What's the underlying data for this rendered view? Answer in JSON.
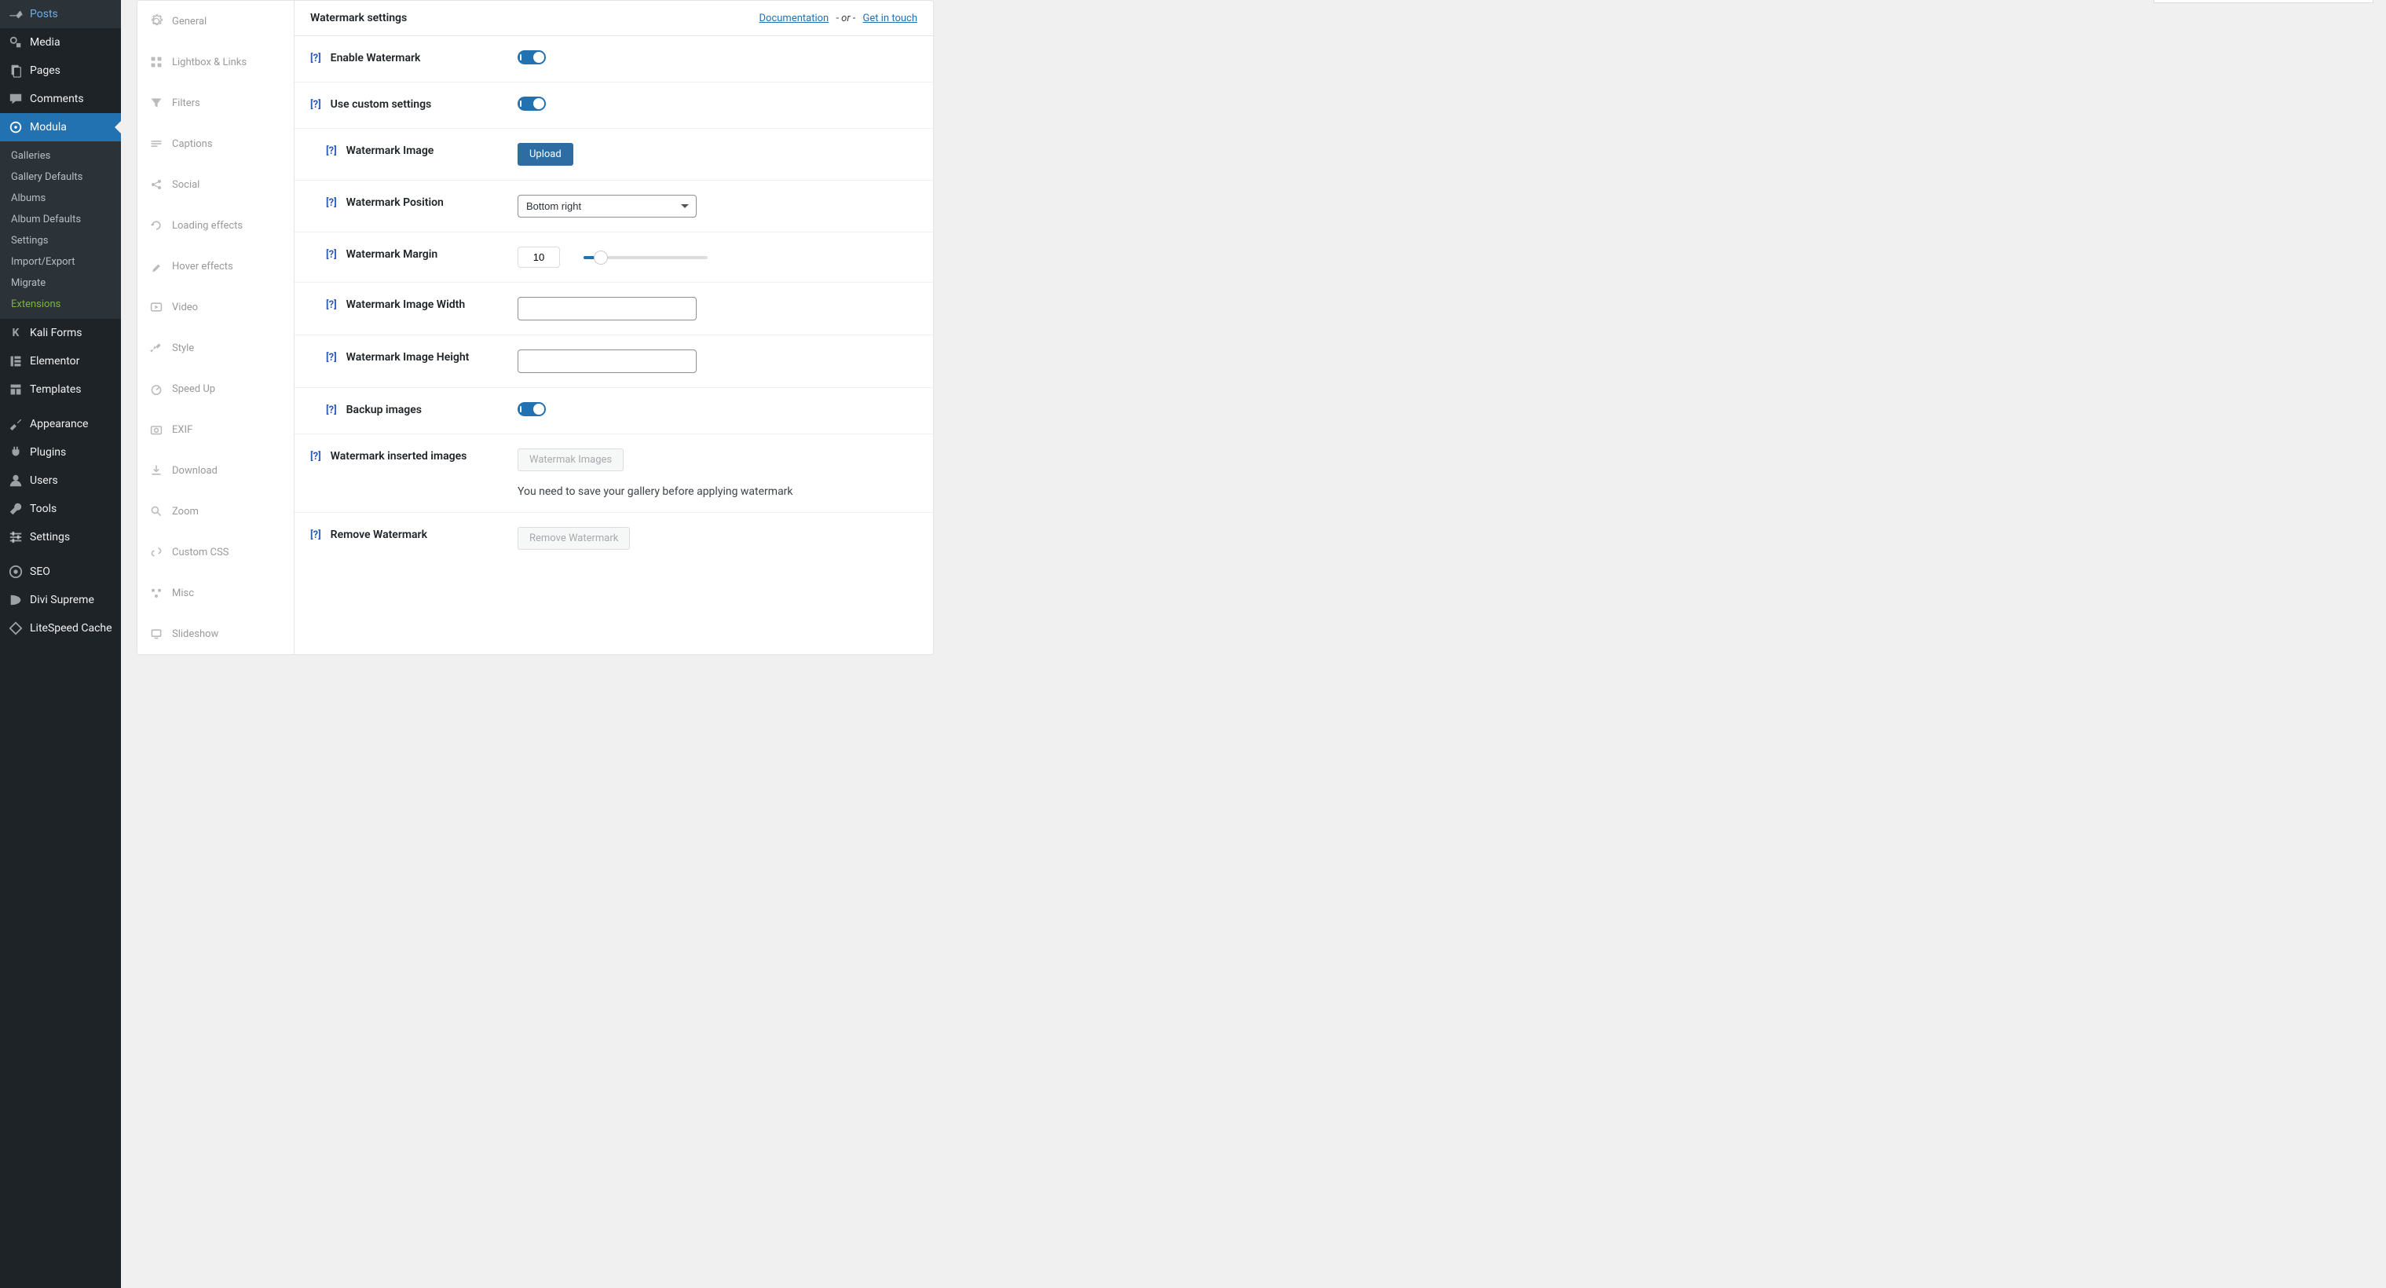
{
  "sidebar": {
    "items": [
      {
        "icon": "pin",
        "label": "Posts"
      },
      {
        "icon": "media",
        "label": "Media"
      },
      {
        "icon": "page",
        "label": "Pages"
      },
      {
        "icon": "comment",
        "label": "Comments"
      },
      {
        "icon": "modula",
        "label": "Modula",
        "active": true
      },
      {
        "icon": "k",
        "label": "Kali Forms"
      },
      {
        "icon": "elementor",
        "label": "Elementor"
      },
      {
        "icon": "template",
        "label": "Templates"
      },
      {
        "icon": "appearance",
        "label": "Appearance"
      },
      {
        "icon": "plugin",
        "label": "Plugins"
      },
      {
        "icon": "user",
        "label": "Users"
      },
      {
        "icon": "tools",
        "label": "Tools"
      },
      {
        "icon": "settings",
        "label": "Settings"
      },
      {
        "icon": "seo",
        "label": "SEO"
      },
      {
        "icon": "divi",
        "label": "Divi Supreme"
      },
      {
        "icon": "litespeed",
        "label": "LiteSpeed Cache"
      }
    ],
    "submenu": [
      "Galleries",
      "Gallery Defaults",
      "Albums",
      "Album Defaults",
      "Settings",
      "Import/Export",
      "Migrate",
      "Extensions"
    ]
  },
  "tabs": [
    {
      "icon": "gear",
      "label": "General"
    },
    {
      "icon": "grid",
      "label": "Lightbox & Links"
    },
    {
      "icon": "filter",
      "label": "Filters"
    },
    {
      "icon": "caption",
      "label": "Captions"
    },
    {
      "icon": "social",
      "label": "Social"
    },
    {
      "icon": "loading",
      "label": "Loading effects"
    },
    {
      "icon": "hover",
      "label": "Hover effects"
    },
    {
      "icon": "video",
      "label": "Video"
    },
    {
      "icon": "style",
      "label": "Style"
    },
    {
      "icon": "speed",
      "label": "Speed Up"
    },
    {
      "icon": "exif",
      "label": "EXIF"
    },
    {
      "icon": "download",
      "label": "Download"
    },
    {
      "icon": "zoom",
      "label": "Zoom"
    },
    {
      "icon": "css",
      "label": "Custom CSS"
    },
    {
      "icon": "misc",
      "label": "Misc"
    },
    {
      "icon": "slideshow",
      "label": "Slideshow"
    }
  ],
  "panel": {
    "title": "Watermark settings",
    "doc_link": "Documentation",
    "or_text": "- or -",
    "contact_link": "Get in touch"
  },
  "help": "[?]",
  "rows": {
    "enable": {
      "label": "Enable Watermark",
      "on": true
    },
    "custom": {
      "label": "Use custom settings",
      "on": true
    },
    "image": {
      "label": "Watermark Image",
      "button": "Upload"
    },
    "position": {
      "label": "Watermark Position",
      "value": "Bottom right"
    },
    "margin": {
      "label": "Watermark Margin",
      "value": "10"
    },
    "width": {
      "label": "Watermark Image Width",
      "value": ""
    },
    "height": {
      "label": "Watermark Image Height",
      "value": ""
    },
    "backup": {
      "label": "Backup images",
      "on": true
    },
    "inserted": {
      "label": "Watermark inserted images",
      "button": "Watermak Images",
      "help": "You need to save your gallery before applying watermark"
    },
    "remove": {
      "label": "Remove Watermark",
      "button": "Remove Watermark"
    }
  }
}
